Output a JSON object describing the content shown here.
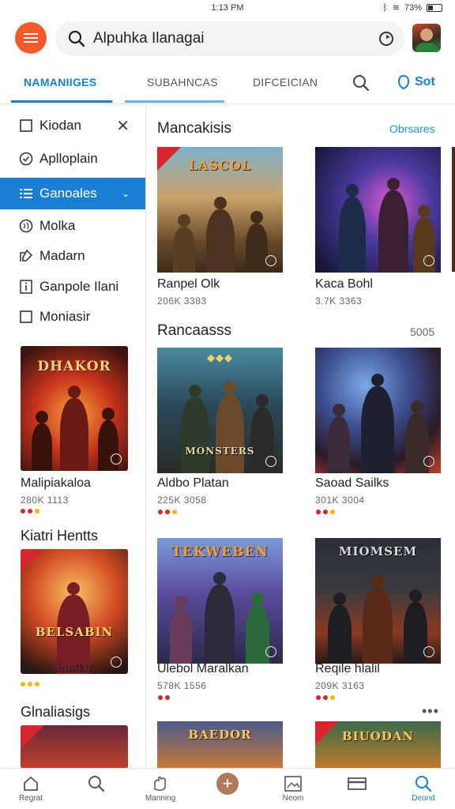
{
  "status_bar": {
    "time": "1:13 PM",
    "battery": "73%"
  },
  "search": {
    "value": "Alpuhka Ilanagai"
  },
  "tabs": [
    {
      "label": "NAMANIIGES"
    },
    {
      "label": "SUBAHNCAS"
    },
    {
      "label": "DIFCEICIAN"
    }
  ],
  "tab_right_label": "Sot",
  "sidebar": {
    "items": [
      {
        "label": "Kiodan",
        "icon": "checkbox-icon"
      },
      {
        "label": "Aplloplain",
        "icon": "check-circle-icon"
      },
      {
        "label": "Ganoales",
        "icon": "list-icon"
      },
      {
        "label": "Molka",
        "icon": "globe-icon"
      },
      {
        "label": "Madarn",
        "icon": "edit-icon"
      },
      {
        "label": "Ganpole Ilani",
        "icon": "info-box-icon"
      },
      {
        "label": "Moniasir",
        "icon": "checkbox-icon"
      }
    ],
    "card1": {
      "banner": "DHAKOR",
      "title": "Malipiakaloa",
      "meta": "280K 1113"
    },
    "heading": "Kiatri Hentts",
    "card2": {
      "banner": "BELSABIN",
      "title": "Aice I Joatkin",
      "meta": ""
    },
    "heading2": "Glnaliasigs"
  },
  "main": {
    "section1": {
      "title": "Mancakisis",
      "link": "Obrsares",
      "games": [
        {
          "banner": "LASCOL",
          "title": "Ranpel Olk",
          "meta": "206K 3383"
        },
        {
          "banner": "",
          "title": "Kaca Bohl",
          "meta": "3.7K 3363"
        }
      ]
    },
    "section2": {
      "title": "Rancaasss",
      "link": "5005",
      "games": [
        {
          "banner": "MONSTERS",
          "title": "Aldbo Platan",
          "meta": "225K 3058"
        },
        {
          "banner": "",
          "title": "Saoad Sailks",
          "meta": "301K 3004"
        }
      ]
    },
    "section3": {
      "games": [
        {
          "banner": "TEKWEBEN",
          "title": "Ulebol Maralkan",
          "meta": "578K 1556"
        },
        {
          "banner": "MIOMSEM",
          "title": "Reqile hlalil",
          "meta": "209K 3163"
        }
      ]
    },
    "section4": {
      "games": [
        {
          "banner": "BAEDOR"
        },
        {
          "banner": "BIUODAN"
        }
      ]
    },
    "more": "•••"
  },
  "bottom_nav": [
    {
      "label": "Regrat"
    },
    {
      "label": ""
    },
    {
      "label": "Manning"
    },
    {
      "label": ""
    },
    {
      "label": "Neom"
    },
    {
      "label": ""
    },
    {
      "label": "Deond"
    }
  ],
  "colors": {
    "accent": "#1a7fd4",
    "menu": "#f15a29",
    "rating_red": "#d8262e",
    "rating_yellow": "#f2b705"
  }
}
